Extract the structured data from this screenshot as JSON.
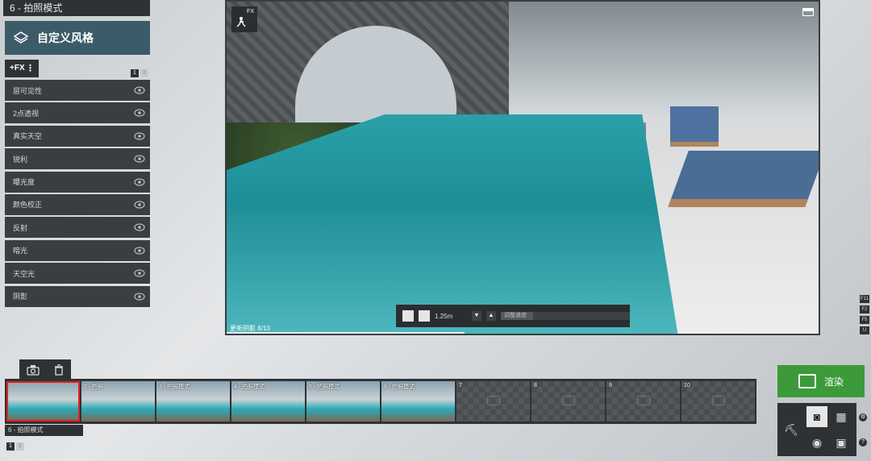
{
  "mode": {
    "title": "6 - 拍照模式"
  },
  "style_panel": {
    "title": "自定义风格",
    "icon": "layers-icon"
  },
  "fx_button": {
    "label": "+FX",
    "menu": "⋮"
  },
  "fx_pager": [
    "1",
    "2"
  ],
  "effects": [
    {
      "label": "层可见性"
    },
    {
      "label": "2点透视"
    },
    {
      "label": "真实天空"
    },
    {
      "label": "锐利"
    },
    {
      "label": "曝光度"
    },
    {
      "label": "颜色校正"
    },
    {
      "label": "反射"
    },
    {
      "label": "暗光"
    },
    {
      "label": "天空光"
    },
    {
      "label": "阴影"
    }
  ],
  "viewport": {
    "badge": "FX",
    "toolbar": {
      "value": "1.25m",
      "slider_label": "调整速度",
      "slider_fraction": 0.25
    },
    "status": "更新阴影 6/10",
    "progress_fraction": 0.4
  },
  "shortcut_keys": [
    "F11",
    "F2",
    "F5",
    "U"
  ],
  "thumbnails": [
    {
      "label": "",
      "filled": true,
      "selected": true
    },
    {
      "label": "2 - 拍照",
      "filled": true
    },
    {
      "label": "3 - 拍照模式",
      "filled": true
    },
    {
      "label": "4 - 拍照模式",
      "filled": true
    },
    {
      "label": "5 - 拍照模式",
      "filled": true
    },
    {
      "label": "6 - 拍照模式",
      "filled": true
    },
    {
      "label": "7",
      "filled": false
    },
    {
      "label": "8",
      "filled": false
    },
    {
      "label": "9",
      "filled": false
    },
    {
      "label": "10",
      "filled": false
    }
  ],
  "thumb_caption": "6 - 拍照模式",
  "bottom_pager": [
    "1",
    "2"
  ],
  "render_button": {
    "label": "渲染",
    "color": "#3c9a3a"
  },
  "colors": {
    "panel": "#2f3234",
    "accent": "#3c5b69",
    "selected": "#e02020"
  }
}
